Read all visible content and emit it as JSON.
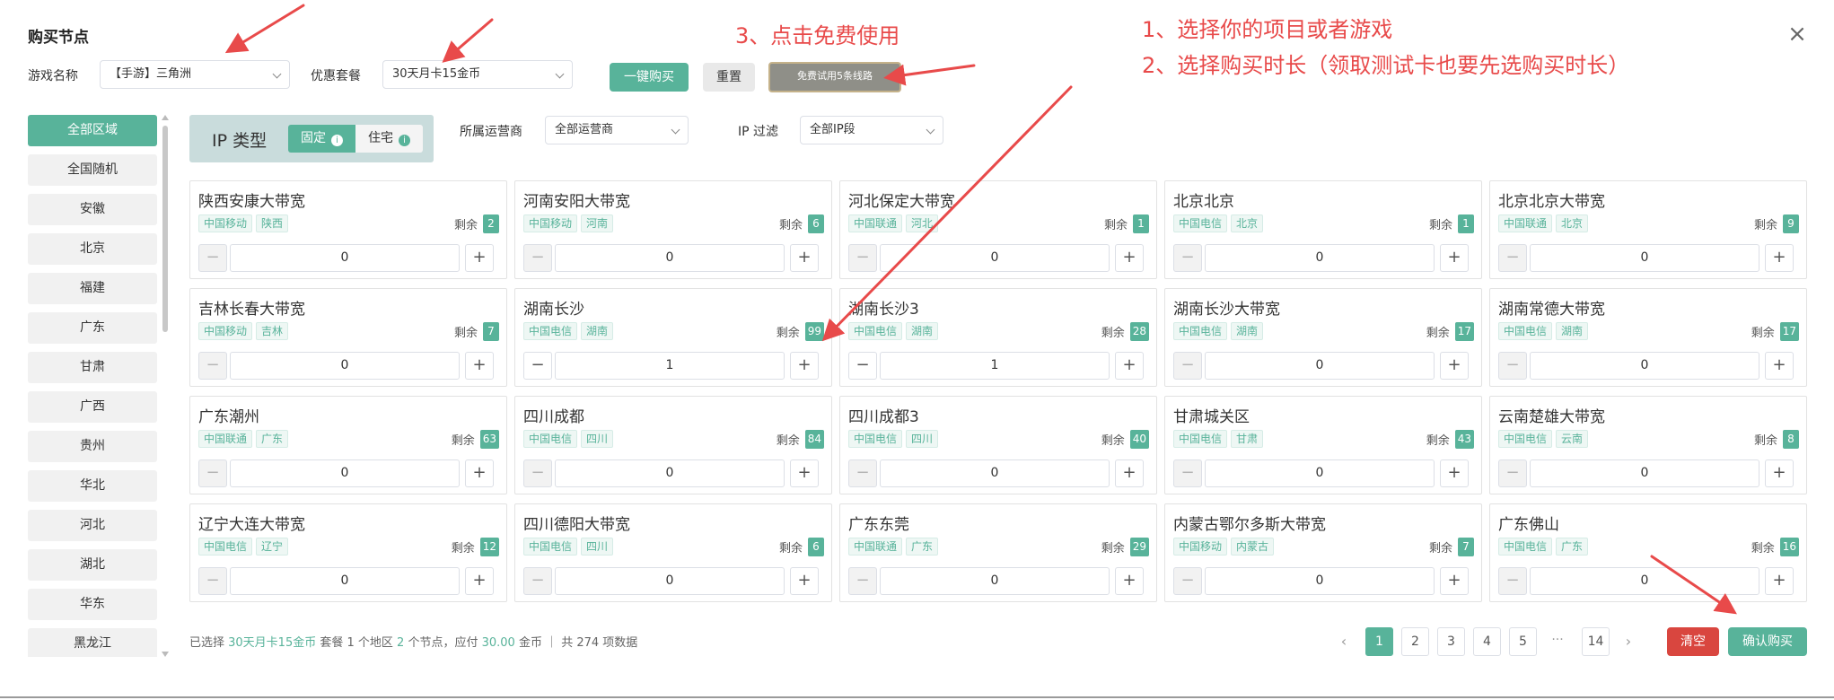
{
  "dialog": {
    "title": "购买节点",
    "close_symbol": "×"
  },
  "toolbar": {
    "game_label": "游戏名称",
    "game_value": "【手游】三角洲",
    "package_label": "优惠套餐",
    "package_value": "30天月卡15金币",
    "buy_one_click": "一键购买",
    "reset": "重置",
    "free_trial": "免费试用5条线路"
  },
  "annotations": {
    "step1": "1、选择你的项目或者游戏",
    "step2": "2、选择购买时长（领取测试卡也要先选购买时长）",
    "step3": "3、点击免费使用"
  },
  "sidebar": {
    "items": [
      "全部区域",
      "全国随机",
      "安徽",
      "北京",
      "福建",
      "广东",
      "甘肃",
      "广西",
      "贵州",
      "华北",
      "河北",
      "湖北",
      "华东",
      "黑龙江"
    ],
    "active_index": 0
  },
  "filters": {
    "ip_type_label": "IP 类型",
    "ip_type_options": [
      "固定",
      "住宅"
    ],
    "ip_type_selected": "固定",
    "info_icon": "i",
    "operator_label": "所属运营商",
    "operator_value": "全部运营商",
    "ip_filter_label": "IP 过滤",
    "ip_filter_value": "全部IP段"
  },
  "remain_label": "剩余",
  "nodes": [
    {
      "name": "陕西安康大带宽",
      "isp": "中国移动",
      "region": "陕西",
      "remain": "2",
      "qty": "0"
    },
    {
      "name": "河南安阳大带宽",
      "isp": "中国移动",
      "region": "河南",
      "remain": "6",
      "qty": "0"
    },
    {
      "name": "河北保定大带宽",
      "isp": "中国联通",
      "region": "河北",
      "remain": "1",
      "qty": "0"
    },
    {
      "name": "北京北京",
      "isp": "中国电信",
      "region": "北京",
      "remain": "1",
      "qty": "0"
    },
    {
      "name": "北京北京大带宽",
      "isp": "中国联通",
      "region": "北京",
      "remain": "9",
      "qty": "0"
    },
    {
      "name": "吉林长春大带宽",
      "isp": "中国移动",
      "region": "吉林",
      "remain": "7",
      "qty": "0"
    },
    {
      "name": "湖南长沙",
      "isp": "中国电信",
      "region": "湖南",
      "remain": "99",
      "qty": "1"
    },
    {
      "name": "湖南长沙3",
      "isp": "中国电信",
      "region": "湖南",
      "remain": "28",
      "qty": "1"
    },
    {
      "name": "湖南长沙大带宽",
      "isp": "中国电信",
      "region": "湖南",
      "remain": "17",
      "qty": "0"
    },
    {
      "name": "湖南常德大带宽",
      "isp": "中国电信",
      "region": "湖南",
      "remain": "17",
      "qty": "0"
    },
    {
      "name": "广东潮州",
      "isp": "中国联通",
      "region": "广东",
      "remain": "63",
      "qty": "0"
    },
    {
      "name": "四川成都",
      "isp": "中国电信",
      "region": "四川",
      "remain": "84",
      "qty": "0"
    },
    {
      "name": "四川成都3",
      "isp": "中国电信",
      "region": "四川",
      "remain": "40",
      "qty": "0"
    },
    {
      "name": "甘肃城关区",
      "isp": "中国电信",
      "region": "甘肃",
      "remain": "43",
      "qty": "0"
    },
    {
      "name": "云南楚雄大带宽",
      "isp": "中国电信",
      "region": "云南",
      "remain": "8",
      "qty": "0"
    },
    {
      "name": "辽宁大连大带宽",
      "isp": "中国电信",
      "region": "辽宁",
      "remain": "12",
      "qty": "0"
    },
    {
      "name": "四川德阳大带宽",
      "isp": "中国电信",
      "region": "四川",
      "remain": "6",
      "qty": "0"
    },
    {
      "name": "广东东莞",
      "isp": "中国联通",
      "region": "广东",
      "remain": "29",
      "qty": "0"
    },
    {
      "name": "内蒙古鄂尔多斯大带宽",
      "isp": "中国移动",
      "region": "内蒙古",
      "remain": "7",
      "qty": "0"
    },
    {
      "name": "广东佛山",
      "isp": "中国电信",
      "region": "广东",
      "remain": "16",
      "qty": "0"
    }
  ],
  "summary": {
    "p1": "已选择 ",
    "package": "30天月卡15金币",
    "p2": " 套餐 ",
    "regions": "1",
    "p3": " 个地区 ",
    "nodes": "2",
    "p4": " 个节点，应付 ",
    "amount": "30.00",
    "p5": " 金币 ｜ 共 274 项数据"
  },
  "pagination": {
    "prev": "‹",
    "pages": [
      "1",
      "2",
      "3",
      "4",
      "5"
    ],
    "ellipsis": "···",
    "last": "14",
    "next": "›",
    "current": "1"
  },
  "footer": {
    "clear": "清空",
    "confirm": "确认购买"
  },
  "colors": {
    "accent": "#58b39a",
    "danger": "#d9463f",
    "annotation": "#e84a4a"
  }
}
